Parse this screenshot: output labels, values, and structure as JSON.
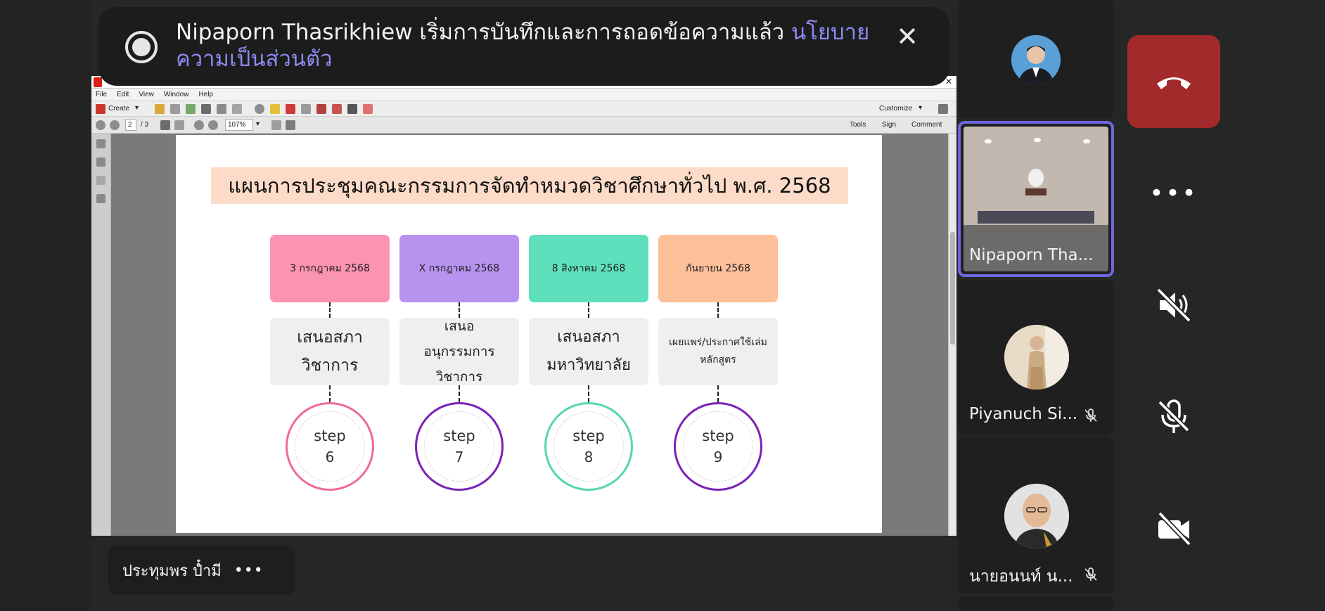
{
  "banner": {
    "message": "Nipaporn Thasrikhiew เริ่มการบันทึกและการถอดข้อความแล้ว",
    "link": "นโยบายความเป็นส่วนตัว"
  },
  "acrobat": {
    "menu": [
      "File",
      "Edit",
      "View",
      "Window",
      "Help"
    ],
    "create_label": "Create",
    "page_current": "2",
    "page_total": "/ 3",
    "zoom": "107%",
    "customize_label": "Customize",
    "tools_label": "Tools",
    "sign_label": "Sign",
    "comment_label": "Comment"
  },
  "slide": {
    "title": "แผนการประชุมคณะกรรมการจัดทำหมวดวิชาศึกษาทั่วไป พ.ศ. 2568",
    "columns": [
      {
        "date": "3 กรกฎาคม 2568",
        "desc": "เสนอสภาวิชาการ",
        "step_word": "step",
        "step_num": "6",
        "date_color": "#fb93b2",
        "ring_color": "#f06a95"
      },
      {
        "date": "X กรกฎาคม 2568",
        "desc": "เสนออนุกรรมการวิชาการ",
        "step_word": "step",
        "step_num": "7",
        "date_color": "#b792ef",
        "ring_color": "#7b22b8"
      },
      {
        "date": "8 สิงหาคม 2568",
        "desc": "เสนอสภามหาวิทยาลัย",
        "step_word": "step",
        "step_num": "8",
        "date_color": "#5ee0bd",
        "ring_color": "#56d6b3"
      },
      {
        "date": "กันยายน 2568",
        "desc": "เผยแพร่/ประกาศใช้เล่มหลักสูตร",
        "step_word": "step",
        "step_num": "9",
        "date_color": "#fec09b",
        "ring_color": "#7b22b8"
      }
    ]
  },
  "bottom": {
    "presenter_name": "ประทุมพร ป๋ำมี",
    "more": "•••"
  },
  "participants": [
    {
      "name": "",
      "avatar": "man-in-suit"
    },
    {
      "name": "Nipaporn Tha...",
      "active": true
    },
    {
      "name": "Piyanuch Si...",
      "muted": true
    },
    {
      "name": "นายอนนท์ น...",
      "muted": true
    }
  ],
  "controls": {
    "more": "•••"
  },
  "colors": {
    "background": "#262626",
    "end_call": "#a32a2a",
    "active_border": "#6f67e0",
    "link": "#8e8bf2"
  }
}
